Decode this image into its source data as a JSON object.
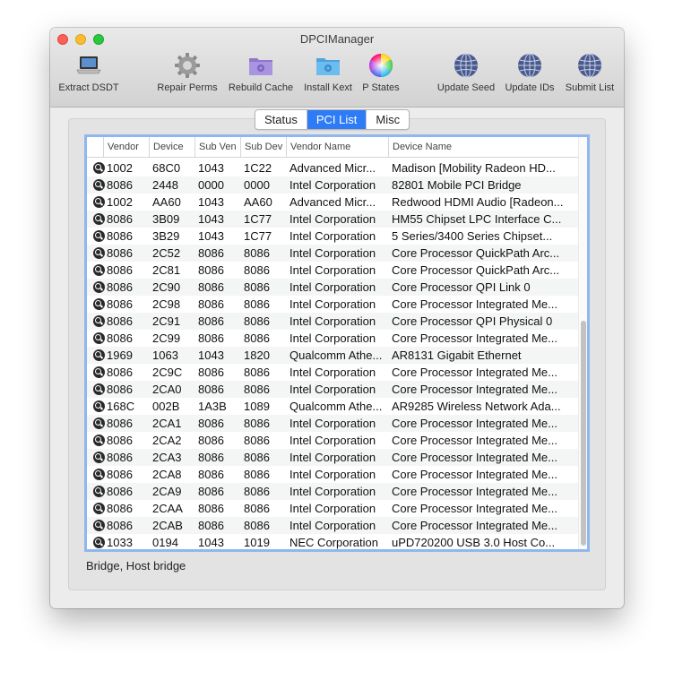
{
  "window": {
    "title": "DPCIManager"
  },
  "toolbar": [
    {
      "id": "extract-dsdt",
      "label": "Extract DSDT",
      "icon": "laptop-icon"
    },
    {
      "id": "repair-perms",
      "label": "Repair Perms",
      "icon": "gear-icon"
    },
    {
      "id": "rebuild-cache",
      "label": "Rebuild Cache",
      "icon": "purple-folder-icon"
    },
    {
      "id": "install-kext",
      "label": "Install Kext",
      "icon": "blue-folder-icon"
    },
    {
      "id": "p-states",
      "label": "P States",
      "icon": "color-wheel-icon"
    },
    {
      "id": "update-seed",
      "label": "Update Seed",
      "icon": "globe-icon"
    },
    {
      "id": "update-ids",
      "label": "Update IDs",
      "icon": "globe-icon"
    },
    {
      "id": "submit-list",
      "label": "Submit List",
      "icon": "globe-icon"
    }
  ],
  "tabs": [
    {
      "label": "Status",
      "active": false
    },
    {
      "label": "PCI List",
      "active": true
    },
    {
      "label": "Misc",
      "active": false
    }
  ],
  "table": {
    "headers": [
      "Vendor",
      "Device",
      "Sub Ven",
      "Sub Dev",
      "Vendor Name",
      "Device Name"
    ],
    "rows": [
      [
        "1002",
        "68C0",
        "1043",
        "1C22",
        "Advanced Micr...",
        "Madison [Mobility Radeon HD..."
      ],
      [
        "8086",
        "2448",
        "0000",
        "0000",
        "Intel Corporation",
        "82801 Mobile PCI Bridge"
      ],
      [
        "1002",
        "AA60",
        "1043",
        "AA60",
        "Advanced Micr...",
        "Redwood HDMI Audio [Radeon..."
      ],
      [
        "8086",
        "3B09",
        "1043",
        "1C77",
        "Intel Corporation",
        "HM55 Chipset LPC Interface C..."
      ],
      [
        "8086",
        "3B29",
        "1043",
        "1C77",
        "Intel Corporation",
        "5 Series/3400 Series Chipset..."
      ],
      [
        "8086",
        "2C52",
        "8086",
        "8086",
        "Intel Corporation",
        "Core Processor QuickPath Arc..."
      ],
      [
        "8086",
        "2C81",
        "8086",
        "8086",
        "Intel Corporation",
        "Core Processor QuickPath Arc..."
      ],
      [
        "8086",
        "2C90",
        "8086",
        "8086",
        "Intel Corporation",
        "Core Processor QPI Link 0"
      ],
      [
        "8086",
        "2C98",
        "8086",
        "8086",
        "Intel Corporation",
        "Core Processor Integrated Me..."
      ],
      [
        "8086",
        "2C91",
        "8086",
        "8086",
        "Intel Corporation",
        "Core Processor QPI Physical 0"
      ],
      [
        "8086",
        "2C99",
        "8086",
        "8086",
        "Intel Corporation",
        "Core Processor Integrated Me..."
      ],
      [
        "1969",
        "1063",
        "1043",
        "1820",
        "Qualcomm Athe...",
        "AR8131 Gigabit Ethernet"
      ],
      [
        "8086",
        "2C9C",
        "8086",
        "8086",
        "Intel Corporation",
        "Core Processor Integrated Me..."
      ],
      [
        "8086",
        "2CA0",
        "8086",
        "8086",
        "Intel Corporation",
        "Core Processor Integrated Me..."
      ],
      [
        "168C",
        "002B",
        "1A3B",
        "1089",
        "Qualcomm Athe...",
        "AR9285 Wireless Network Ada..."
      ],
      [
        "8086",
        "2CA1",
        "8086",
        "8086",
        "Intel Corporation",
        "Core Processor Integrated Me..."
      ],
      [
        "8086",
        "2CA2",
        "8086",
        "8086",
        "Intel Corporation",
        "Core Processor Integrated Me..."
      ],
      [
        "8086",
        "2CA3",
        "8086",
        "8086",
        "Intel Corporation",
        "Core Processor Integrated Me..."
      ],
      [
        "8086",
        "2CA8",
        "8086",
        "8086",
        "Intel Corporation",
        "Core Processor Integrated Me..."
      ],
      [
        "8086",
        "2CA9",
        "8086",
        "8086",
        "Intel Corporation",
        "Core Processor Integrated Me..."
      ],
      [
        "8086",
        "2CAA",
        "8086",
        "8086",
        "Intel Corporation",
        "Core Processor Integrated Me..."
      ],
      [
        "8086",
        "2CAB",
        "8086",
        "8086",
        "Intel Corporation",
        "Core Processor Integrated Me..."
      ],
      [
        "1033",
        "0194",
        "1043",
        "1019",
        "NEC Corporation",
        "uPD720200 USB 3.0 Host Co..."
      ]
    ]
  },
  "status_text": "Bridge, Host bridge",
  "colors": {
    "accent": "#2d7cf6",
    "focus_ring": "#8fb7ee"
  }
}
